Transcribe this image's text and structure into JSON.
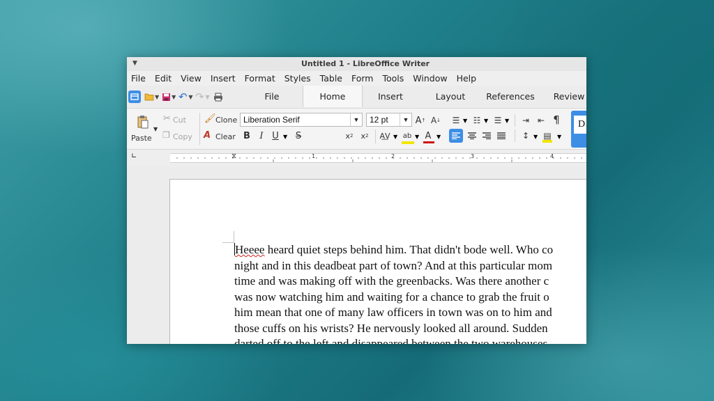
{
  "window": {
    "title": "Untitled 1 - LibreOffice Writer"
  },
  "menu": [
    "File",
    "Edit",
    "View",
    "Insert",
    "Format",
    "Styles",
    "Table",
    "Form",
    "Tools",
    "Window",
    "Help"
  ],
  "tabs": [
    {
      "label": "File"
    },
    {
      "label": "Home"
    },
    {
      "label": "Insert"
    },
    {
      "label": "Layout"
    },
    {
      "label": "References"
    },
    {
      "label": "Review"
    }
  ],
  "toolbar": {
    "paste_label": "Paste",
    "cut_label": "Cut",
    "copy_label": "Copy",
    "clone_label": "Clone",
    "clear_label": "Clear",
    "font_name": "Liberation Serif",
    "font_size": "12 pt",
    "style_preview": "D"
  },
  "ruler": {
    "numbers": [
      "1",
      "2",
      "3",
      "4"
    ]
  },
  "document": {
    "first_word_misspelled": "Heeee",
    "lines": [
      " heard quiet steps behind him. That didn't bode well. Who co",
      "night and in this deadbeat part of town? And at this particular mom",
      "time and was making off with the greenbacks. Was there another c",
      "was now watching him and waiting for a chance to grab the fruit o",
      "him mean that one of many law officers in town was on to him and",
      "those cuffs on his wrists? He nervously looked all around. Sudden",
      "darted off to the left and disappeared between the two warehouses"
    ]
  },
  "colors": {
    "accent": "#3d8ee5",
    "font_color_bar": "#d01010",
    "highlight_bar": "#f2e600"
  }
}
